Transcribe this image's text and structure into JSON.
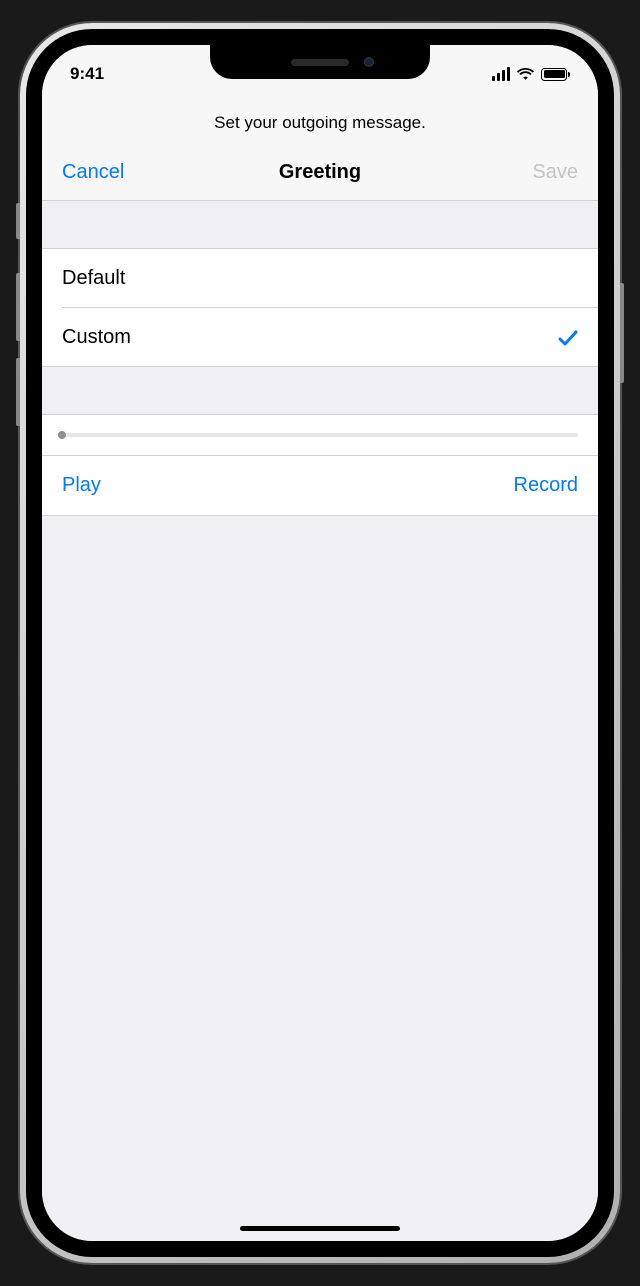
{
  "status_bar": {
    "time": "9:41"
  },
  "header": {
    "subtitle": "Set your outgoing message.",
    "cancel_label": "Cancel",
    "title": "Greeting",
    "save_label": "Save"
  },
  "options": {
    "default_label": "Default",
    "custom_label": "Custom",
    "selected": "custom"
  },
  "actions": {
    "play_label": "Play",
    "record_label": "Record"
  },
  "colors": {
    "accent": "#007aff",
    "disabled": "#c4c4c6",
    "background": "#efeff4"
  }
}
